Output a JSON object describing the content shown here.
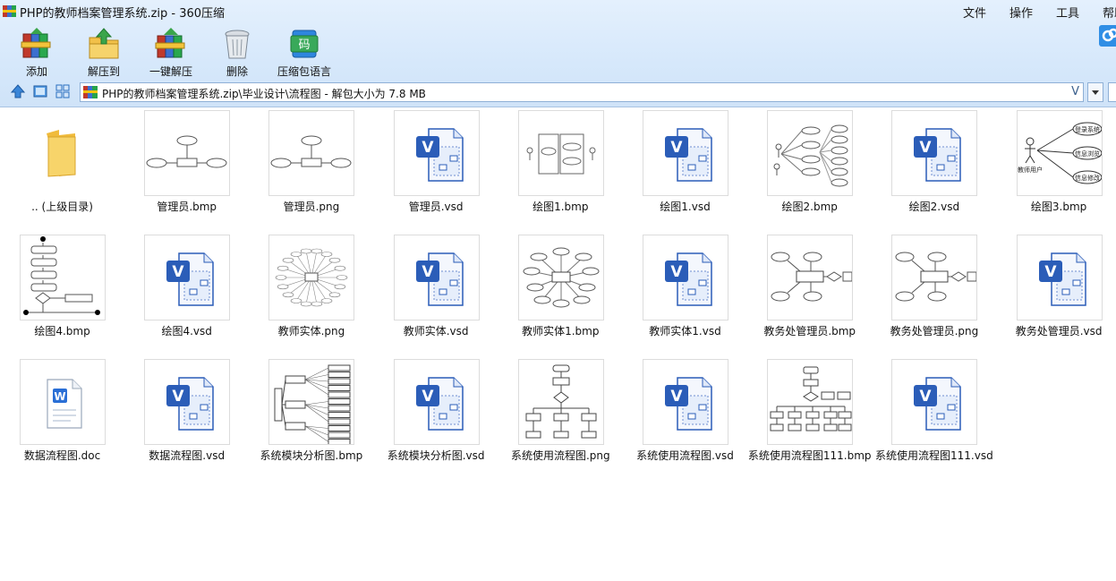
{
  "window": {
    "title": "PHP的教师档案管理系统.zip - 360压缩",
    "menu": [
      "文件",
      "操作",
      "工具",
      "帮助"
    ]
  },
  "toolbar": [
    {
      "label": "添加",
      "icon": "books-add-icon"
    },
    {
      "label": "解压到",
      "icon": "extract-folder-icon"
    },
    {
      "label": "一键解压",
      "icon": "one-click-extract-icon"
    },
    {
      "label": "删除",
      "icon": "trash-icon"
    },
    {
      "label": "压缩包语言",
      "icon": "language-code-icon"
    }
  ],
  "address": {
    "path": "PHP的教师档案管理系统.zip\\毕业设计\\流程图 - 解包大小为 7.8 MB",
    "v_mark": "V"
  },
  "files": [
    {
      "name": ".. (上级目录)",
      "kind": "folder"
    },
    {
      "name": "管理员.bmp",
      "kind": "er1"
    },
    {
      "name": "管理员.png",
      "kind": "er1"
    },
    {
      "name": "管理员.vsd",
      "kind": "vsd"
    },
    {
      "name": "绘图1.bmp",
      "kind": "usecase1"
    },
    {
      "name": "绘图1.vsd",
      "kind": "vsd"
    },
    {
      "name": "绘图2.bmp",
      "kind": "usecase2"
    },
    {
      "name": "绘图2.vsd",
      "kind": "vsd"
    },
    {
      "name": "绘图3.bmp",
      "kind": "usecase3"
    },
    {
      "name": "绘图4.bmp",
      "kind": "flow1"
    },
    {
      "name": "绘图4.vsd",
      "kind": "vsd"
    },
    {
      "name": "教师实体.png",
      "kind": "star"
    },
    {
      "name": "教师实体.vsd",
      "kind": "vsd"
    },
    {
      "name": "教师实体1.bmp",
      "kind": "er2"
    },
    {
      "name": "教师实体1.vsd",
      "kind": "vsd"
    },
    {
      "name": "教务处管理员.bmp",
      "kind": "er3"
    },
    {
      "name": "教务处管理员.png",
      "kind": "er3"
    },
    {
      "name": "教务处管理员.vsd",
      "kind": "vsd"
    },
    {
      "name": "数据流程图.doc",
      "kind": "doc"
    },
    {
      "name": "数据流程图.vsd",
      "kind": "vsd"
    },
    {
      "name": "系统模块分析图.bmp",
      "kind": "tree"
    },
    {
      "name": "系统模块分析图.vsd",
      "kind": "vsd"
    },
    {
      "name": "系统使用流程图.png",
      "kind": "flow2"
    },
    {
      "name": "系统使用流程图.vsd",
      "kind": "vsd"
    },
    {
      "name": "系统使用流程图111.bmp",
      "kind": "flow3"
    },
    {
      "name": "系统使用流程图111.vsd",
      "kind": "vsd"
    }
  ],
  "thumb_text": {
    "usecase3": [
      "教师用户",
      "登录系统",
      "信息浏览",
      "信息修改"
    ]
  },
  "colors": {
    "chrome_top": "#e4f0fd",
    "vsd_blue": "#2b5db8",
    "doc_blue": "#2a6fd6",
    "folder_yellow": "#f3c64a"
  }
}
